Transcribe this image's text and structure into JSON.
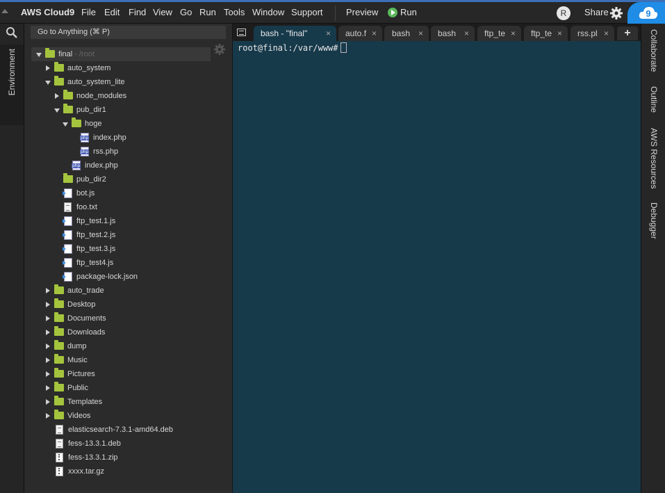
{
  "menubar": {
    "logo": "AWS Cloud9",
    "menus": [
      "File",
      "Edit",
      "Find",
      "View",
      "Go",
      "Run",
      "Tools",
      "Window",
      "Support"
    ],
    "preview": "Preview",
    "run": "Run",
    "avatar_initial": "R",
    "share": "Share"
  },
  "left_panel": {
    "environment_tab": "Environment"
  },
  "tree": {
    "goto_placeholder": "Go to Anything (⌘ P)",
    "root_name": "final",
    "root_path": " - /root",
    "rows": [
      {
        "label": "auto_system"
      },
      {
        "label": "auto_system_lite"
      },
      {
        "label": "node_modules"
      },
      {
        "label": "pub_dir1"
      },
      {
        "label": "hoge"
      },
      {
        "label": "index.php"
      },
      {
        "label": "rss.php"
      },
      {
        "label": "index.php"
      },
      {
        "label": "pub_dir2"
      },
      {
        "label": "bot.js"
      },
      {
        "label": "foo.txt"
      },
      {
        "label": "ftp_test.1.js"
      },
      {
        "label": "ftp_test.2.js"
      },
      {
        "label": "ftp_test.3.js"
      },
      {
        "label": "ftp_test4.js"
      },
      {
        "label": "package-lock.json"
      },
      {
        "label": "auto_trade"
      },
      {
        "label": "Desktop"
      },
      {
        "label": "Documents"
      },
      {
        "label": "Downloads"
      },
      {
        "label": "dump"
      },
      {
        "label": "Music"
      },
      {
        "label": "Pictures"
      },
      {
        "label": "Public"
      },
      {
        "label": "Templates"
      },
      {
        "label": "Videos"
      },
      {
        "label": "elasticsearch-7.3.1-amd64.deb"
      },
      {
        "label": "fess-13.3.1.deb"
      },
      {
        "label": "fess-13.3.1.zip"
      },
      {
        "label": "xxxx.tar.gz"
      }
    ]
  },
  "tabs": [
    {
      "label": "bash - \"final\"",
      "close": "×"
    },
    {
      "label": "auto.f",
      "close": "×"
    },
    {
      "label": "bash",
      "close": "×"
    },
    {
      "label": "bash",
      "close": "×"
    },
    {
      "label": "ftp_te",
      "close": "×"
    },
    {
      "label": "ftp_te",
      "close": "×"
    },
    {
      "label": "rss.pl",
      "close": "×"
    }
  ],
  "new_tab": "+",
  "terminal": {
    "prompt": "root@final:/var/www#"
  },
  "right_panel": [
    "Collaborate",
    "Outline",
    "AWS Resources",
    "Debugger"
  ],
  "colors": {
    "accent": "#1f8ce6",
    "folder": "#a5c43d",
    "terminal_bg": "#173a4b"
  }
}
